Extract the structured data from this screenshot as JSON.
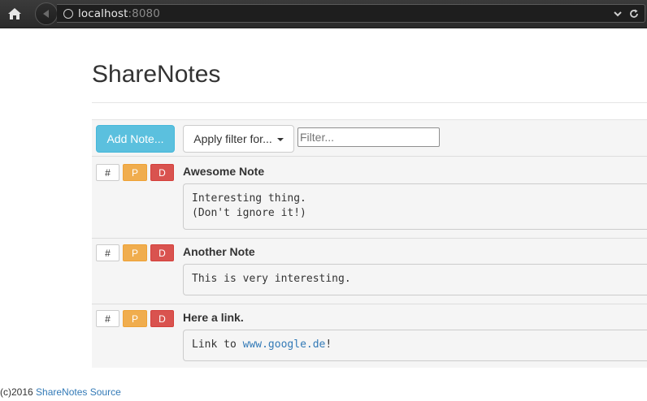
{
  "browser": {
    "url_host": "localhost",
    "url_port": ":8080"
  },
  "page": {
    "title": "ShareNotes"
  },
  "toolbar": {
    "add_note_label": "Add Note...",
    "apply_filter_label": "Apply filter for...",
    "filter_placeholder": "Filter..."
  },
  "notes": [
    {
      "title": "Awesome Note",
      "lines": [
        "Interesting thing.",
        "(Don't ignore it!)"
      ],
      "hash_label": "#",
      "p_label": "P",
      "d_label": "D"
    },
    {
      "title": "Another Note",
      "lines": [
        "This is very interesting."
      ],
      "hash_label": "#",
      "p_label": "P",
      "d_label": "D"
    },
    {
      "title": "Here a link.",
      "link_prefix": "Link to ",
      "link_text": "www.google.de",
      "link_suffix": "!",
      "hash_label": "#",
      "p_label": "P",
      "d_label": "D"
    }
  ],
  "footer": {
    "copyright": "(c)2016 ",
    "source_link": "ShareNotes Source"
  },
  "colors": {
    "info": "#5bc0de",
    "warning": "#f0ad4e",
    "danger": "#d9534f",
    "link": "#337ab7"
  }
}
